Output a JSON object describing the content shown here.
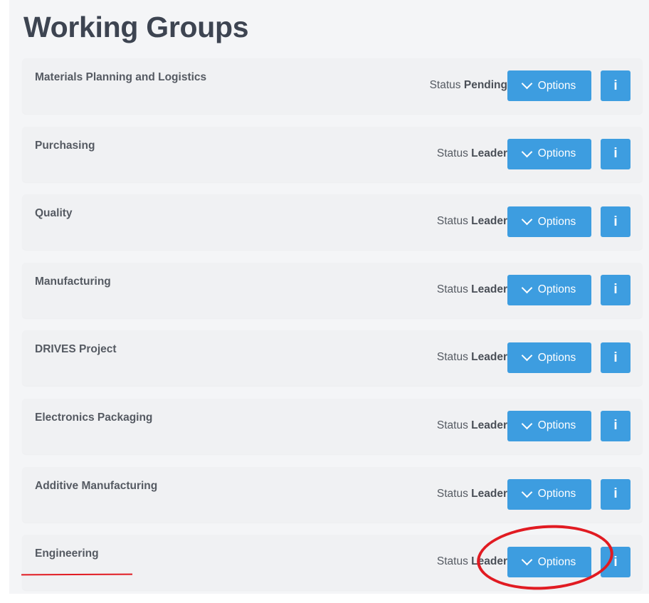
{
  "page": {
    "title": "Working Groups"
  },
  "labels": {
    "status_prefix": "Status",
    "options": "Options",
    "info": "i"
  },
  "groups": [
    {
      "name": "Materials Planning and Logistics",
      "status": "Pending"
    },
    {
      "name": "Purchasing",
      "status": "Leader"
    },
    {
      "name": "Quality",
      "status": "Leader"
    },
    {
      "name": "Manufacturing",
      "status": "Leader"
    },
    {
      "name": "DRIVES Project",
      "status": "Leader"
    },
    {
      "name": "Electronics Packaging",
      "status": "Leader"
    },
    {
      "name": "Additive Manufacturing",
      "status": "Leader"
    },
    {
      "name": "Engineering",
      "status": "Leader"
    }
  ],
  "icons": {
    "options": "chevron-down-icon",
    "info": "info-icon"
  },
  "colors": {
    "button": "#3d9de0",
    "annotation": "#e11b22",
    "title": "#3d4451",
    "text": "#555a62"
  }
}
